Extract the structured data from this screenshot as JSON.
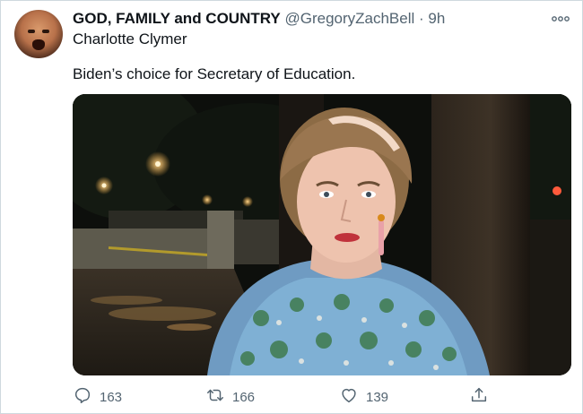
{
  "tweet": {
    "display_name": "GOD, FAMILY and COUNTRY",
    "handle": "@GregoryZachBell",
    "separator": "·",
    "time": "9h",
    "more_icon": "more-dots-icon",
    "subline": "Charlotte Clymer",
    "text": "Biden’s choice for Secretary of Education."
  },
  "actions": {
    "reply_count": "163",
    "retweet_count": "166",
    "like_count": "139"
  },
  "icons": [
    "reply-icon",
    "retweet-icon",
    "like-icon",
    "share-icon"
  ],
  "colors": {
    "muted": "#536471",
    "text": "#0f1419",
    "border": "#cfd9de"
  }
}
